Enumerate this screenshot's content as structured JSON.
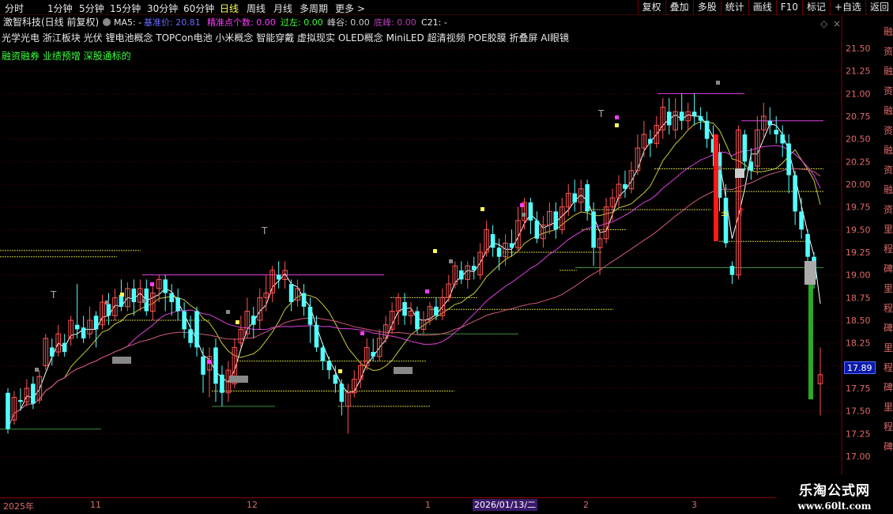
{
  "header": {
    "periods": [
      "分时",
      "1分钟",
      "5分钟",
      "15分钟",
      "30分钟",
      "60分钟",
      "日线",
      "周线",
      "月线",
      "多周期",
      "更多 >"
    ],
    "active_period": "日线",
    "tools": [
      "复权",
      "叠加",
      "多股",
      "统计",
      "画线",
      "F10",
      "标记",
      "+自选",
      "返回"
    ]
  },
  "title_line": {
    "stock": "激智科技(日线 前复权)",
    "ma_label": "MA5: -",
    "items": [
      {
        "text": "基准价: 20.81",
        "color": "#6a6aff"
      },
      {
        "text": "精准点个数: 0.00",
        "color": "#ff3cff"
      },
      {
        "text": "过左: 0.00",
        "color": "#3cff3c"
      },
      {
        "text": "峰谷: 0.00",
        "color": "#d0d0d0"
      },
      {
        "text": "底峰: 0.00",
        "color": "#b040b0"
      },
      {
        "text": "C21: -",
        "color": "#e8e8e8"
      }
    ]
  },
  "concepts": "光学光电  浙江板块  光伏 锂电池概念 TOPCon电池 小米概念 智能穿戴 虚拟现实 OLED概念 MiniLED 超清视频 POE胶膜 折叠屏 AI眼镜",
  "tags": "融资融券 业绩预增 深股通标的",
  "right_axis": {
    "ticks": [
      21.5,
      21.25,
      21.0,
      20.75,
      20.5,
      20.25,
      20.0,
      19.75,
      19.5,
      19.25,
      19.0,
      18.75,
      18.5,
      18.25,
      18.0,
      17.75,
      17.5,
      17.25,
      17.0
    ],
    "range": [
      17.0,
      21.5
    ],
    "current_price": "17.89",
    "side_labels": [
      "融",
      "资",
      "融",
      "资",
      "融",
      "资",
      "融",
      "资",
      "融",
      "资",
      "里",
      "程",
      "碑",
      "里",
      "程",
      "碑",
      "里",
      "程",
      "碑",
      "里",
      "程",
      "碑"
    ]
  },
  "date_axis": {
    "labels": [
      "2025年",
      "11",
      "12",
      "1",
      "2",
      "3"
    ],
    "highlight": "2026/01/13/二"
  },
  "watermark": {
    "title": "乐淘公式网",
    "url": "www.60lt.com"
  },
  "colors": {
    "up": "#ff5454",
    "down": "#54ffff",
    "grid": "#5a0000",
    "ma_white": "#ffffff",
    "ma_yellow": "#c8c83c",
    "ma_magenta": "#e040e0",
    "ma_pink": "#d05a78"
  },
  "chart_data": {
    "type": "candlestick",
    "price_range": [
      17.0,
      21.5
    ],
    "current_price": 17.89,
    "candles": [
      [
        17.7,
        17.3,
        17.75,
        17.25
      ],
      [
        17.4,
        17.65,
        17.72,
        17.35
      ],
      [
        17.62,
        17.6,
        17.75,
        17.5
      ],
      [
        17.6,
        17.75,
        17.85,
        17.55
      ],
      [
        17.8,
        17.58,
        17.88,
        17.52
      ],
      [
        17.62,
        17.88,
        17.95,
        17.58
      ],
      [
        18.0,
        18.3,
        18.35,
        17.95
      ],
      [
        18.2,
        18.1,
        18.3,
        18.0
      ],
      [
        18.15,
        18.35,
        18.45,
        18.1
      ],
      [
        18.25,
        18.15,
        18.35,
        18.1
      ],
      [
        18.3,
        18.5,
        18.55,
        18.22
      ],
      [
        18.45,
        18.4,
        18.9,
        18.3
      ],
      [
        18.42,
        18.3,
        18.55,
        18.25
      ],
      [
        18.35,
        18.5,
        18.65,
        18.3
      ],
      [
        18.55,
        18.4,
        18.6,
        18.2
      ],
      [
        18.45,
        18.7,
        18.78,
        18.4
      ],
      [
        18.68,
        18.55,
        18.8,
        18.45
      ],
      [
        18.55,
        18.75,
        18.85,
        18.5
      ],
      [
        18.78,
        18.65,
        18.95,
        18.6
      ],
      [
        18.65,
        18.85,
        18.92,
        18.6
      ],
      [
        18.85,
        18.7,
        18.95,
        18.55
      ],
      [
        18.7,
        18.85,
        18.95,
        18.6
      ],
      [
        18.85,
        18.6,
        18.95,
        18.55
      ],
      [
        18.6,
        18.8,
        18.9,
        18.5
      ],
      [
        18.85,
        18.95,
        19.0,
        18.7
      ],
      [
        18.95,
        18.8,
        19.0,
        18.6
      ],
      [
        18.8,
        18.7,
        18.9,
        18.55
      ],
      [
        18.75,
        18.6,
        18.85,
        18.5
      ],
      [
        18.6,
        18.4,
        18.7,
        18.3
      ],
      [
        18.4,
        18.25,
        18.55,
        18.2
      ],
      [
        18.6,
        18.2,
        18.65,
        18.1
      ],
      [
        18.1,
        17.9,
        18.2,
        17.7
      ],
      [
        17.95,
        18.1,
        18.2,
        17.65
      ],
      [
        18.2,
        17.8,
        18.3,
        17.6
      ],
      [
        17.9,
        17.7,
        18.0,
        17.55
      ],
      [
        17.7,
        17.95,
        18.05,
        17.6
      ],
      [
        17.8,
        18.2,
        18.3,
        17.75
      ],
      [
        18.25,
        18.4,
        18.55,
        18.2
      ],
      [
        18.35,
        18.6,
        18.75,
        18.3
      ],
      [
        18.55,
        18.45,
        18.65,
        18.3
      ],
      [
        18.5,
        18.75,
        18.85,
        18.4
      ],
      [
        18.75,
        18.8,
        19.0,
        18.6
      ],
      [
        18.8,
        19.05,
        19.1,
        18.7
      ],
      [
        19.0,
        18.95,
        19.15,
        18.85
      ],
      [
        18.95,
        19.05,
        19.15,
        18.85
      ],
      [
        18.9,
        18.7,
        18.95,
        18.6
      ],
      [
        18.72,
        18.85,
        18.95,
        18.65
      ],
      [
        18.8,
        18.65,
        18.9,
        18.55
      ],
      [
        18.65,
        18.45,
        18.75,
        18.25
      ],
      [
        18.45,
        18.2,
        18.55,
        18.15
      ],
      [
        18.2,
        18.05,
        18.25,
        17.95
      ],
      [
        18.05,
        17.95,
        18.1,
        17.85
      ],
      [
        17.9,
        17.8,
        18.0,
        17.7
      ],
      [
        17.8,
        17.6,
        17.85,
        17.45
      ],
      [
        17.55,
        17.7,
        17.8,
        17.25
      ],
      [
        17.7,
        17.85,
        17.95,
        17.65
      ],
      [
        17.85,
        18.0,
        18.05,
        17.75
      ],
      [
        18.0,
        18.2,
        18.3,
        17.95
      ],
      [
        18.15,
        18.1,
        18.3,
        18.05
      ],
      [
        18.1,
        18.3,
        18.4,
        18.05
      ],
      [
        18.3,
        18.45,
        18.55,
        18.25
      ],
      [
        18.4,
        18.6,
        18.7,
        18.35
      ],
      [
        18.6,
        18.75,
        18.8,
        18.45
      ],
      [
        18.7,
        18.55,
        18.8,
        18.45
      ],
      [
        18.55,
        18.6,
        18.7,
        18.45
      ],
      [
        18.6,
        18.4,
        18.65,
        18.35
      ],
      [
        18.4,
        18.5,
        18.6,
        18.35
      ],
      [
        18.5,
        18.65,
        18.7,
        18.45
      ],
      [
        18.65,
        18.55,
        18.75,
        18.5
      ],
      [
        18.55,
        18.75,
        18.85,
        18.5
      ],
      [
        18.75,
        18.9,
        19.0,
        18.7
      ],
      [
        18.9,
        19.1,
        19.15,
        18.85
      ],
      [
        19.05,
        18.95,
        19.15,
        18.9
      ],
      [
        18.95,
        19.1,
        19.15,
        18.85
      ],
      [
        19.1,
        19.05,
        19.2,
        18.95
      ],
      [
        19.0,
        19.25,
        19.35,
        18.95
      ],
      [
        19.25,
        19.5,
        19.6,
        19.2
      ],
      [
        19.45,
        19.3,
        19.55,
        19.2
      ],
      [
        19.3,
        19.2,
        19.4,
        19.05
      ],
      [
        19.2,
        19.35,
        19.45,
        19.1
      ],
      [
        19.35,
        19.3,
        19.5,
        19.2
      ],
      [
        19.3,
        19.6,
        19.75,
        19.25
      ],
      [
        19.6,
        19.8,
        19.85,
        19.5
      ],
      [
        19.8,
        19.6,
        19.85,
        19.45
      ],
      [
        19.6,
        19.4,
        19.7,
        19.35
      ],
      [
        19.4,
        19.55,
        19.65,
        19.3
      ],
      [
        19.55,
        19.7,
        19.8,
        19.45
      ],
      [
        19.7,
        19.5,
        19.8,
        19.4
      ],
      [
        19.5,
        19.75,
        19.85,
        19.45
      ],
      [
        19.75,
        19.9,
        20.0,
        19.65
      ],
      [
        19.9,
        19.8,
        20.05,
        19.7
      ],
      [
        19.8,
        19.95,
        20.05,
        19.7
      ],
      [
        20.0,
        19.7,
        20.05,
        19.6
      ],
      [
        19.7,
        19.3,
        19.8,
        19.1
      ],
      [
        19.3,
        19.4,
        19.5,
        19.0
      ],
      [
        19.4,
        19.75,
        19.85,
        19.35
      ],
      [
        19.75,
        19.85,
        19.95,
        19.6
      ],
      [
        19.85,
        20.0,
        20.1,
        19.75
      ],
      [
        20.0,
        19.95,
        20.15,
        19.85
      ],
      [
        19.95,
        20.15,
        20.25,
        19.9
      ],
      [
        20.15,
        20.4,
        20.55,
        20.1
      ],
      [
        20.4,
        20.55,
        20.7,
        20.3
      ],
      [
        20.5,
        20.45,
        20.6,
        20.3
      ],
      [
        20.45,
        20.65,
        20.75,
        20.4
      ],
      [
        20.6,
        20.85,
        20.95,
        20.5
      ],
      [
        20.8,
        20.65,
        20.95,
        20.55
      ],
      [
        20.6,
        20.8,
        20.95,
        20.5
      ],
      [
        20.8,
        20.7,
        21.0,
        20.6
      ],
      [
        20.7,
        20.8,
        20.9,
        20.6
      ],
      [
        20.8,
        20.75,
        21.0,
        20.65
      ],
      [
        20.75,
        20.7,
        20.85,
        20.6
      ],
      [
        20.7,
        20.5,
        20.8,
        20.4
      ],
      [
        20.5,
        20.35,
        20.65,
        20.2
      ],
      [
        20.35,
        19.85,
        20.45,
        19.7
      ],
      [
        19.85,
        19.35,
        20.0,
        19.3
      ],
      [
        19.1,
        19.0,
        19.15,
        18.9
      ],
      [
        19.0,
        20.6,
        20.65,
        18.95
      ],
      [
        20.55,
        20.25,
        20.6,
        20.15
      ],
      [
        20.25,
        20.15,
        20.4,
        20.05
      ],
      [
        20.2,
        20.6,
        20.75,
        20.1
      ],
      [
        20.6,
        20.75,
        20.9,
        20.5
      ],
      [
        20.7,
        20.65,
        20.85,
        20.55
      ],
      [
        20.6,
        20.55,
        20.75,
        20.45
      ],
      [
        20.55,
        20.45,
        20.65,
        20.3
      ],
      [
        20.45,
        20.1,
        20.55,
        19.9
      ],
      [
        20.1,
        19.7,
        20.15,
        19.55
      ],
      [
        19.7,
        19.5,
        19.85,
        19.4
      ],
      [
        19.45,
        19.2,
        19.5,
        19.0
      ],
      [
        19.2,
        18.95,
        19.25,
        18.85
      ],
      [
        17.8,
        17.9,
        18.2,
        17.45
      ]
    ]
  }
}
